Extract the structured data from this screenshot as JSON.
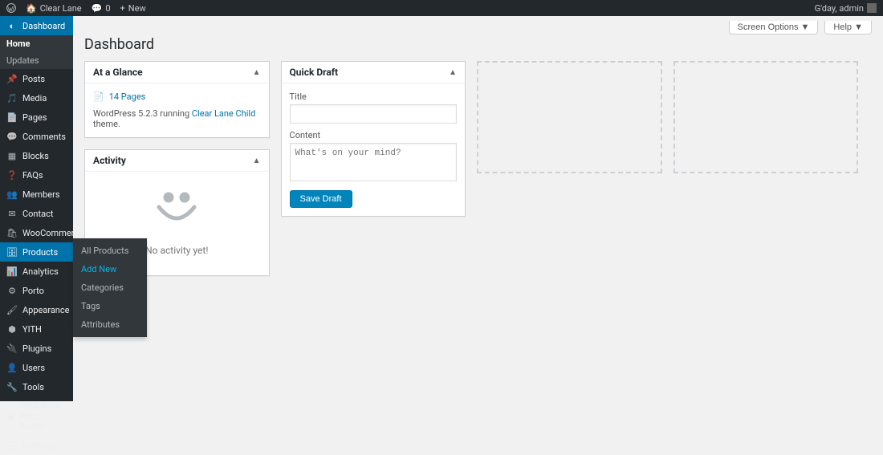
{
  "adminbar": {
    "site_name": "Clear Lane",
    "comments_count": "0",
    "new_label": "New",
    "greeting": "G'day, admin"
  },
  "screen_options_label": "Screen Options ▼",
  "help_label": "Help ▼",
  "page_title": "Dashboard",
  "sidebar": {
    "dashboard": "Dashboard",
    "home": "Home",
    "updates": "Updates",
    "posts": "Posts",
    "media": "Media",
    "pages": "Pages",
    "comments": "Comments",
    "blocks": "Blocks",
    "faqs": "FAQs",
    "members": "Members",
    "contact": "Contact",
    "woocommerce": "WooCommerce",
    "products": "Products",
    "analytics": "Analytics",
    "porto": "Porto",
    "appearance": "Appearance",
    "yith": "YITH",
    "plugins": "Plugins",
    "users": "Users",
    "tools": "Tools",
    "wpbakery": "WPBakery Page Builder",
    "settings": "Settings"
  },
  "flyout": {
    "all_products": "All Products",
    "add_new": "Add New",
    "categories": "Categories",
    "tags": "Tags",
    "attributes": "Attributes"
  },
  "glance": {
    "title": "At a Glance",
    "pages": "14 Pages",
    "version_pre": "WordPress 5.2.3 running ",
    "theme": "Clear Lane Child",
    "version_post": " theme."
  },
  "activity": {
    "title": "Activity",
    "empty": "No activity yet!"
  },
  "draft": {
    "title": "Quick Draft",
    "title_label": "Title",
    "content_label": "Content",
    "content_placeholder": "What's on your mind?",
    "save": "Save Draft"
  }
}
